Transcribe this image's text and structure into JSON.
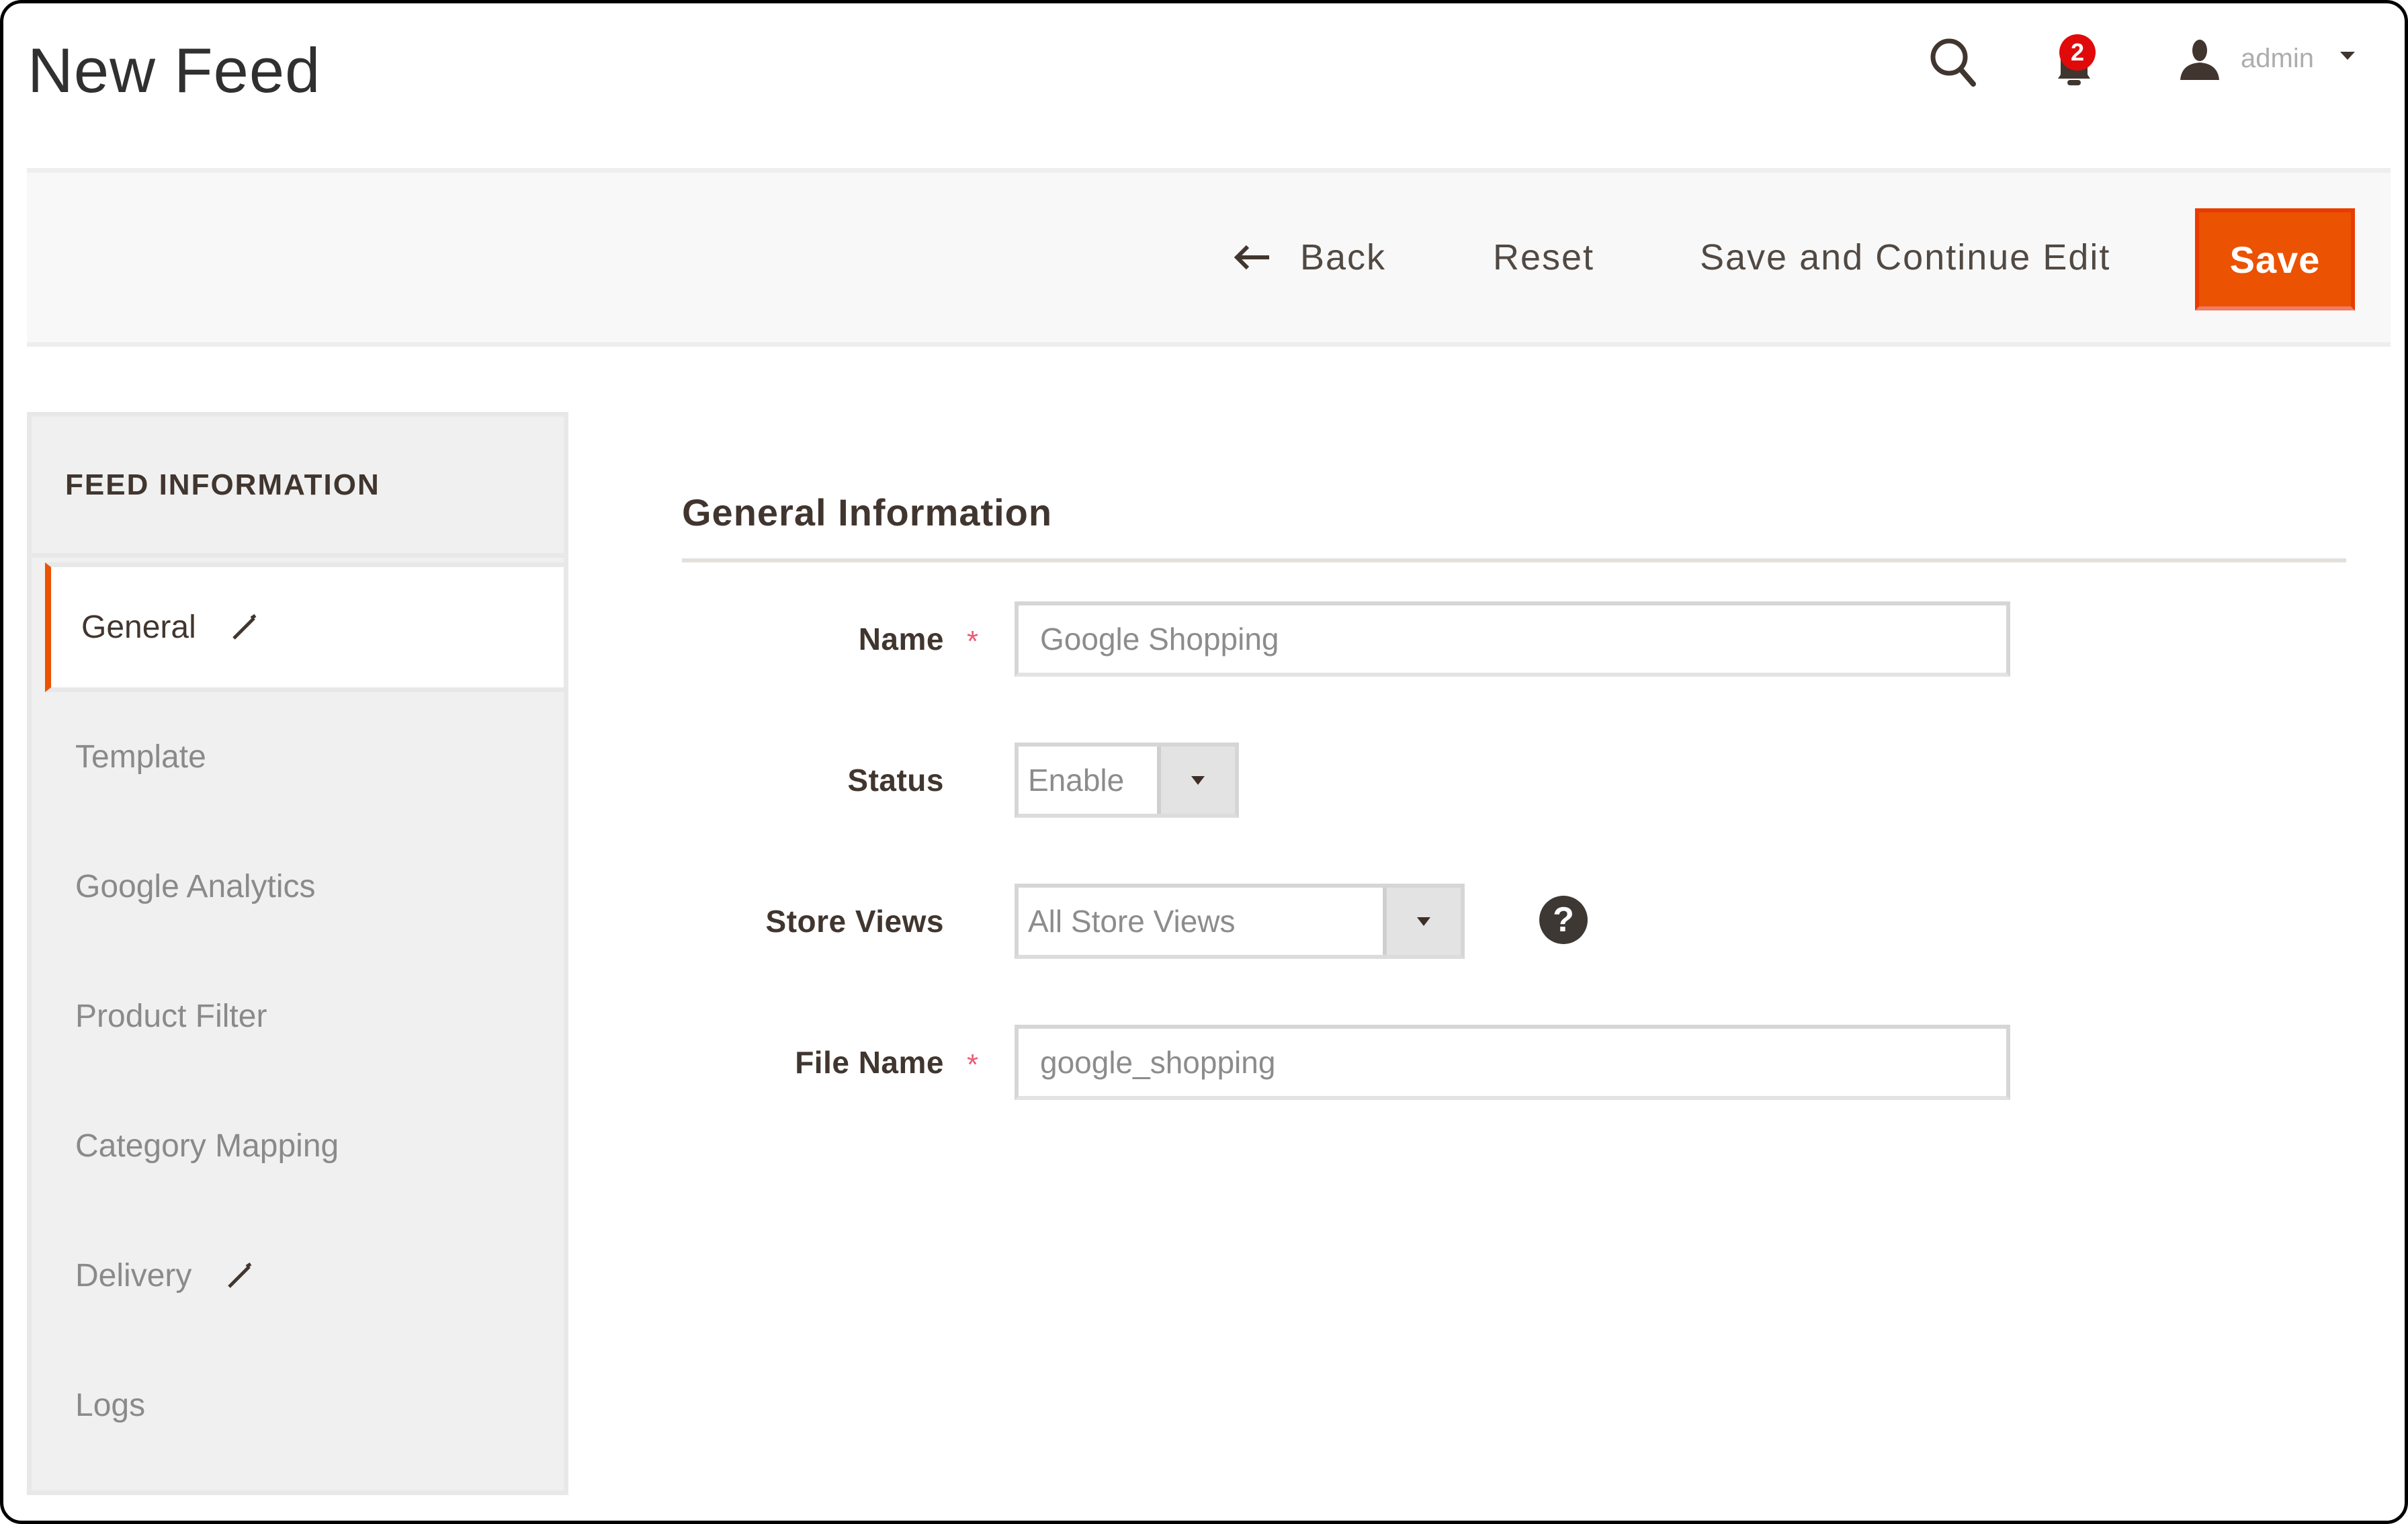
{
  "header": {
    "title": "New Feed",
    "notifications_count": "2",
    "user_name": "admin",
    "icons": {
      "search": "search-icon",
      "notifications": "bell-icon",
      "user": "user-icon",
      "user_menu": "caret-down-icon"
    }
  },
  "toolbar": {
    "back_label": "Back",
    "reset_label": "Reset",
    "save_continue_label": "Save and Continue Edit",
    "save_label": "Save",
    "save_color": "#eb5202"
  },
  "sidebar": {
    "title": "FEED INFORMATION",
    "active_accent": "#eb5202",
    "items": [
      {
        "label": "General",
        "active": true,
        "edited": true
      },
      {
        "label": "Template",
        "active": false,
        "edited": false
      },
      {
        "label": "Google Analytics",
        "active": false,
        "edited": false
      },
      {
        "label": "Product Filter",
        "active": false,
        "edited": false
      },
      {
        "label": "Category Mapping",
        "active": false,
        "edited": false
      },
      {
        "label": "Delivery",
        "active": false,
        "edited": true
      },
      {
        "label": "Logs",
        "active": false,
        "edited": false
      }
    ]
  },
  "form": {
    "section_title": "General Information",
    "required_marker": "*",
    "fields": {
      "name": {
        "label": "Name",
        "value": "Google Shopping",
        "required": true
      },
      "status": {
        "label": "Status",
        "value": "Enable"
      },
      "store_views": {
        "label": "Store Views",
        "value": "All Store Views",
        "help": "?"
      },
      "file_name": {
        "label": "File Name",
        "value": "google_shopping",
        "required": true
      }
    }
  }
}
